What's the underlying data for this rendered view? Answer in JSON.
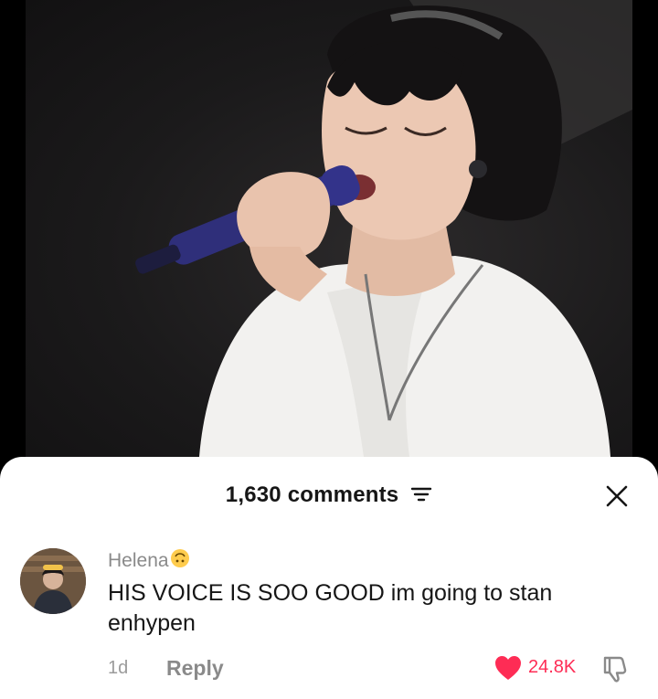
{
  "header": {
    "comment_count": "1,630 comments"
  },
  "comment": {
    "username": "Helena",
    "text": "HIS VOICE IS SOO GOOD im going to stan enhypen",
    "time": "1d",
    "reply_label": "Reply",
    "like_count": "24.8K"
  },
  "colors": {
    "like": "#fe2c55",
    "muted": "#8a8a8a",
    "text": "#161616",
    "sheet": "#ffffff"
  },
  "icons": {
    "sort": "sort-icon",
    "close": "close-icon",
    "emoji": "upside-down-face-emoji",
    "heart": "heart-icon",
    "dislike": "thumbs-down-icon"
  }
}
